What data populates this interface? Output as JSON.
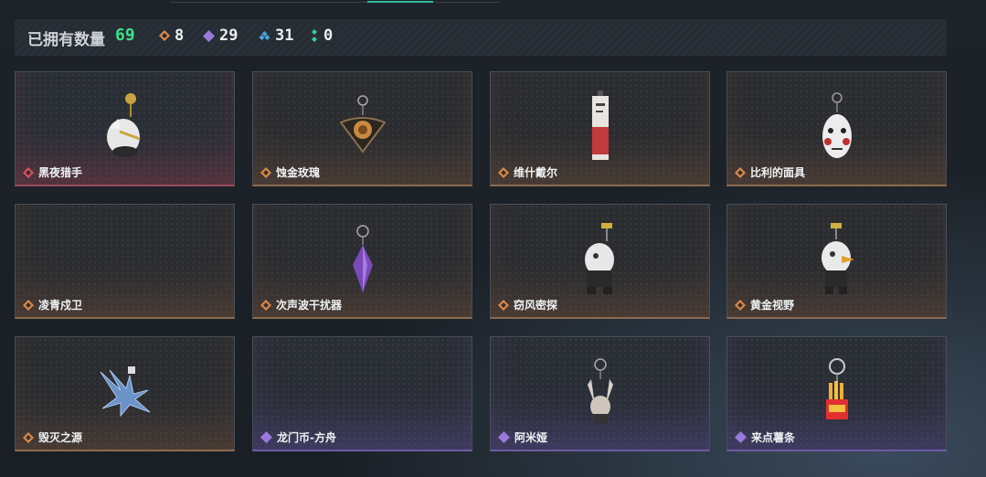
{
  "header": {
    "title": "已拥有数量",
    "owned_count": "69",
    "stats": [
      {
        "icon": "orange-rarity-icon",
        "color": "#d98a4a",
        "value": "8"
      },
      {
        "icon": "purple-rarity-icon",
        "color": "#9a7ad8",
        "value": "29"
      },
      {
        "icon": "blue-rarity-icon",
        "color": "#4aa3e0",
        "value": "31"
      },
      {
        "icon": "green-rarity-icon",
        "color": "#3fc7a0",
        "value": "0"
      }
    ]
  },
  "cards": [
    {
      "name": "黑夜猎手",
      "rarity": "red",
      "icon": "night-hunter-charm-icon"
    },
    {
      "name": "蚀金玫瑰",
      "rarity": "orange",
      "icon": "gold-rose-charm-icon"
    },
    {
      "name": "维什戴尔",
      "rarity": "orange",
      "icon": "wisadel-tag-charm-icon"
    },
    {
      "name": "比利的面具",
      "rarity": "orange",
      "icon": "billy-mask-charm-icon"
    },
    {
      "name": "凌青戍卫",
      "rarity": "orange",
      "icon": ""
    },
    {
      "name": "次声波干扰器",
      "rarity": "orange",
      "icon": "crystal-pendant-charm-icon"
    },
    {
      "name": "窃风密探",
      "rarity": "orange",
      "icon": "wind-spy-charm-icon"
    },
    {
      "name": "黄金视野",
      "rarity": "orange",
      "icon": "golden-vision-charm-icon"
    },
    {
      "name": "毁灭之源",
      "rarity": "orange",
      "icon": "crystal-dragon-charm-icon"
    },
    {
      "name": "龙门币-方舟",
      "rarity": "purple",
      "icon": ""
    },
    {
      "name": "阿米娅",
      "rarity": "purple",
      "icon": "amiya-charm-icon"
    },
    {
      "name": "来点薯条",
      "rarity": "purple",
      "icon": "fries-charm-icon"
    }
  ],
  "colors": {
    "orange": "#d98a4a",
    "red": "#d2525c",
    "purple": "#9a7ad8",
    "accent": "#3ee08a"
  }
}
